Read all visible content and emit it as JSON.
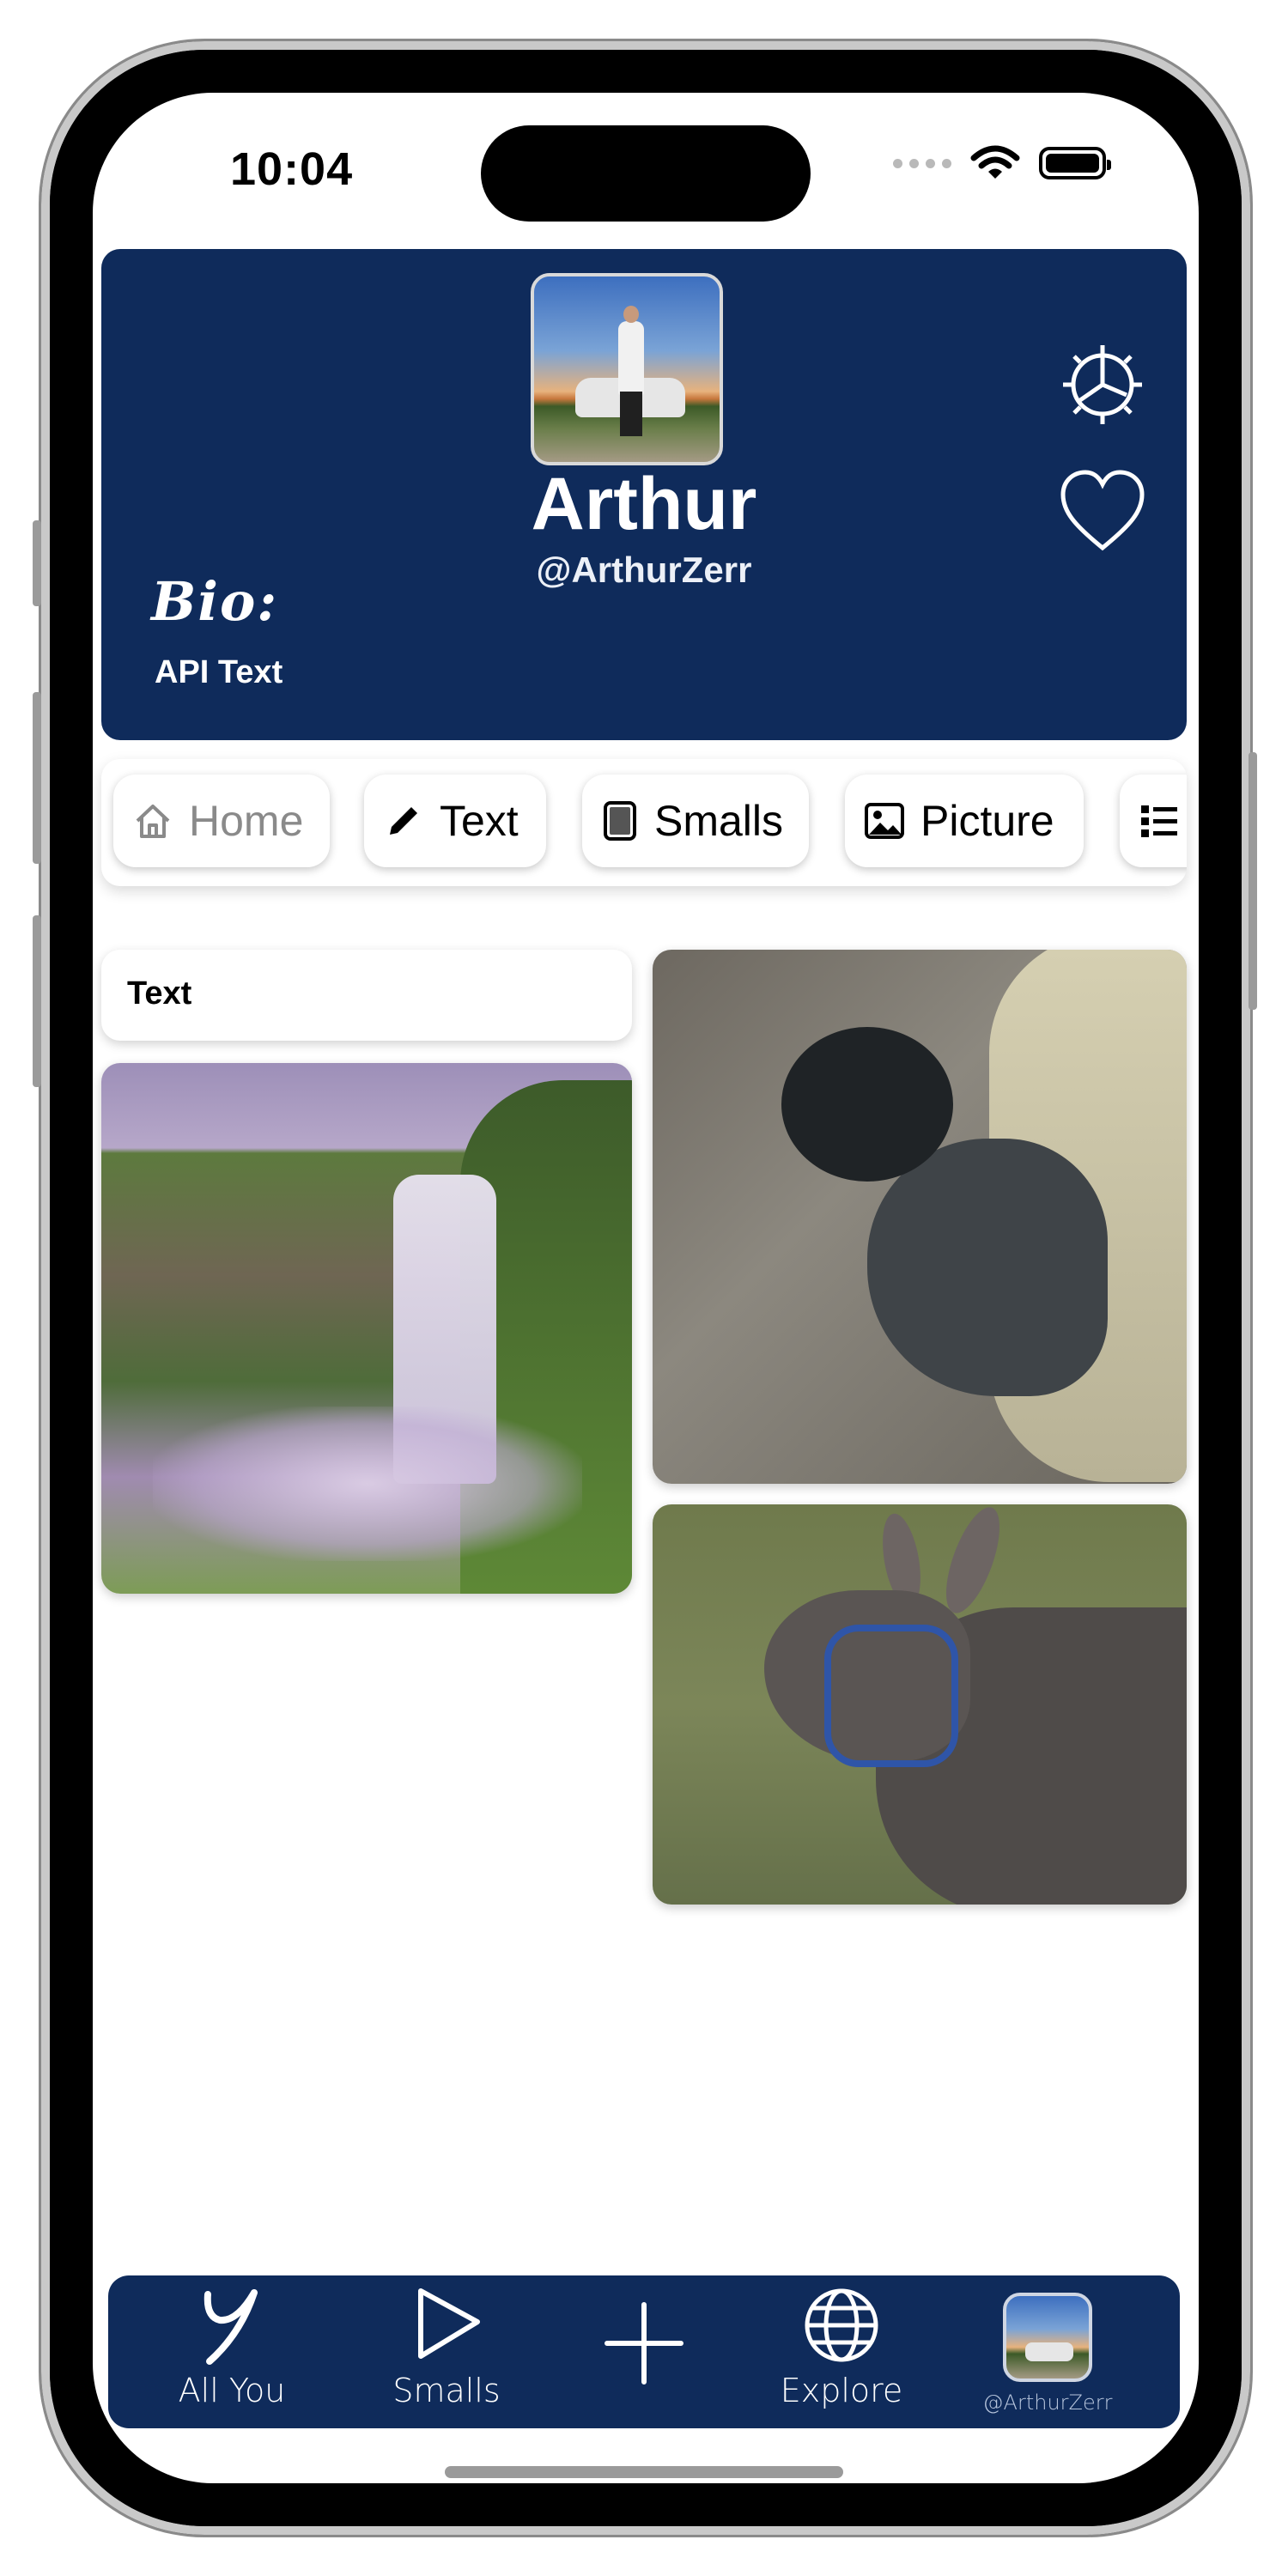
{
  "status_bar": {
    "time": "10:04"
  },
  "profile": {
    "name": "Arthur",
    "handle": "@ArthurZerr",
    "bio_label": "Bio:",
    "bio_text": "API Text",
    "background_color": "#0f2b5b"
  },
  "tabs": [
    {
      "label": "Home",
      "icon": "house-icon",
      "active": true
    },
    {
      "label": "Text",
      "icon": "pencil-icon",
      "active": false
    },
    {
      "label": "Smalls",
      "icon": "tablet-icon",
      "active": false
    },
    {
      "label": "Picture",
      "icon": "photo-icon",
      "active": false
    },
    {
      "label": "",
      "icon": "list-icon",
      "active": false
    }
  ],
  "feed": {
    "text_card": "Text",
    "photos": [
      {
        "subject": "waterfall"
      },
      {
        "subject": "alpaca"
      },
      {
        "subject": "donkey"
      }
    ]
  },
  "bottom_nav": {
    "items": [
      {
        "label": "All You",
        "icon": "y-logo-icon"
      },
      {
        "label": "Smalls",
        "icon": "play-triangle-icon"
      },
      {
        "label": "",
        "icon": "plus-icon"
      },
      {
        "label": "Explore",
        "icon": "globe-icon"
      },
      {
        "label": "@ArthurZerr",
        "icon": "profile-avatar"
      }
    ]
  }
}
